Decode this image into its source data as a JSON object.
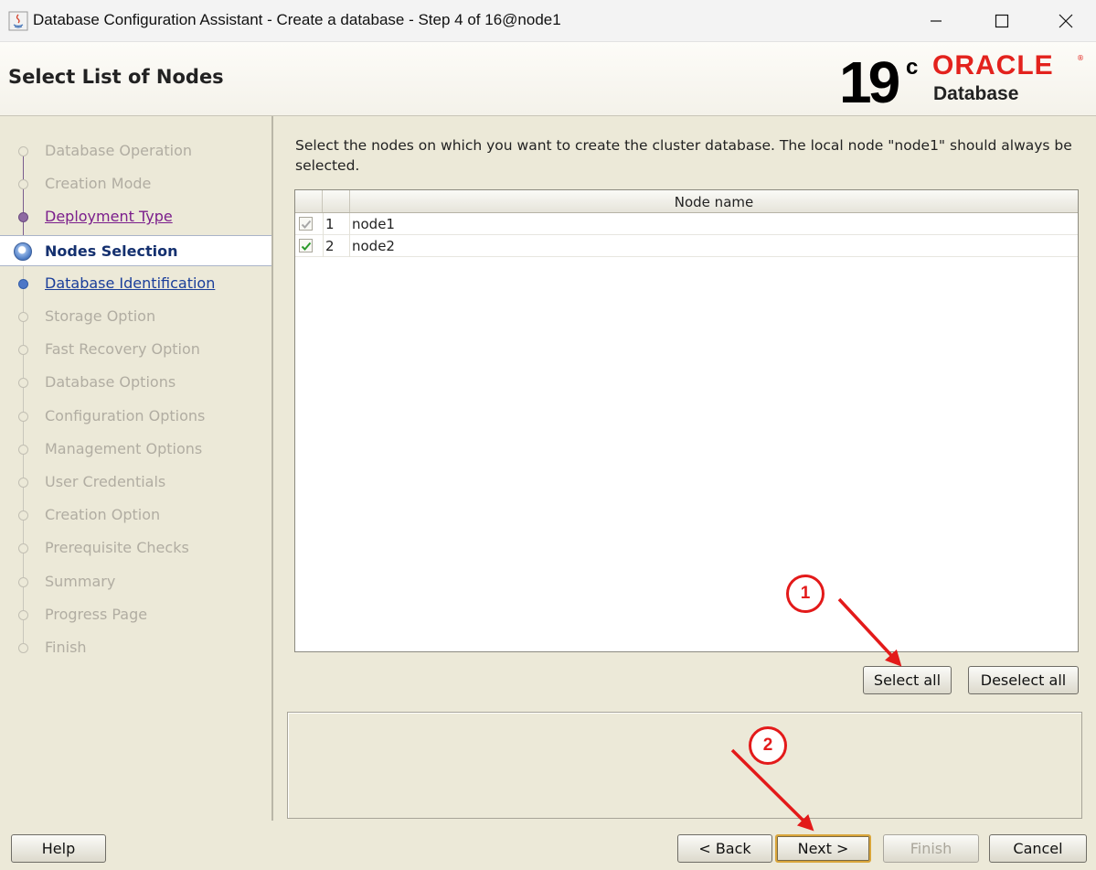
{
  "window": {
    "title": "Database Configuration Assistant - Create a database - Step 4 of 16@node1",
    "minimize_glyph": "—",
    "maximize_glyph": "☐",
    "close_glyph": "✕"
  },
  "header": {
    "page_title": "Select List of Nodes",
    "version_number": "19",
    "version_suffix": "c",
    "brand": "ORACLE",
    "brand_mark": "®",
    "product": "Database",
    "brand_color": "#e3221d"
  },
  "steps": [
    {
      "label": "Database Operation",
      "state": "disabled"
    },
    {
      "label": "Creation Mode",
      "state": "disabled"
    },
    {
      "label": "Deployment Type",
      "state": "visited"
    },
    {
      "label": "Nodes Selection",
      "state": "current"
    },
    {
      "label": "Database Identification",
      "state": "link"
    },
    {
      "label": "Storage Option",
      "state": "disabled"
    },
    {
      "label": "Fast Recovery Option",
      "state": "disabled"
    },
    {
      "label": "Database Options",
      "state": "disabled"
    },
    {
      "label": "Configuration Options",
      "state": "disabled"
    },
    {
      "label": "Management Options",
      "state": "disabled"
    },
    {
      "label": "User Credentials",
      "state": "disabled"
    },
    {
      "label": "Creation Option",
      "state": "disabled"
    },
    {
      "label": "Prerequisite Checks",
      "state": "disabled"
    },
    {
      "label": "Summary",
      "state": "disabled"
    },
    {
      "label": "Progress Page",
      "state": "disabled"
    },
    {
      "label": "Finish",
      "state": "disabled"
    }
  ],
  "content": {
    "instruction": "Select the nodes on which you want to create the cluster database. The local node \"node1\" should always be selected.",
    "table": {
      "column_header": "Node name",
      "rows": [
        {
          "index": "1",
          "name": "node1",
          "checked": true,
          "locked": true
        },
        {
          "index": "2",
          "name": "node2",
          "checked": true,
          "locked": false
        }
      ]
    },
    "select_all_label": "Select all",
    "deselect_all_label": "Deselect all"
  },
  "footer": {
    "help_label": "Help",
    "back_label": "< Back",
    "next_label": "Next >",
    "finish_label": "Finish",
    "cancel_label": "Cancel"
  },
  "annotations": {
    "badge_1": "1",
    "badge_2": "2",
    "color": "#e31a1a"
  }
}
